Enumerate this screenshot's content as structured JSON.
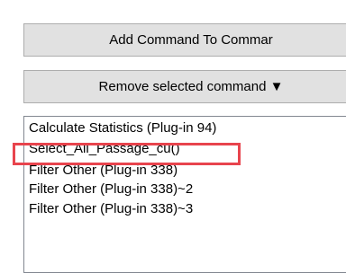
{
  "buttons": {
    "add_label": "Add Command To Commar",
    "remove_label": "Remove selected command ▼"
  },
  "command_list": {
    "items": [
      {
        "label": "Calculate Statistics (Plug-in 94)"
      },
      {
        "label": "Select_All_Passage_cu()"
      },
      {
        "label": "Filter Other (Plug-in 338)"
      },
      {
        "label": "Filter Other (Plug-in 338)~2"
      },
      {
        "label": "Filter Other (Plug-in 338)~3"
      }
    ],
    "highlighted_index": 1
  },
  "colors": {
    "button_bg": "#e1e1e1",
    "highlight": "#e8444d"
  }
}
